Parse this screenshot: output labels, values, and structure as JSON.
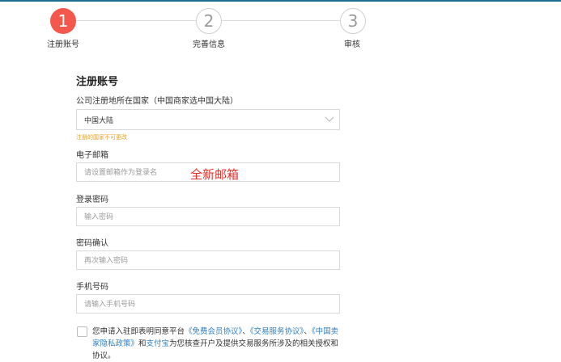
{
  "steps": [
    {
      "number": "1",
      "label": "注册账号",
      "state": "active"
    },
    {
      "number": "2",
      "label": "完善信息",
      "state": "idle"
    },
    {
      "number": "3",
      "label": "审核",
      "state": "idle"
    }
  ],
  "form": {
    "title": "注册账号",
    "country": {
      "label": "公司注册地所在国家（中国商家选中国大陆）",
      "value": "中国大陆",
      "warning": "注册的国家不可更改"
    },
    "email": {
      "label": "电子邮箱",
      "placeholder": "请设置邮箱作为登录名",
      "annotation": "全新邮箱"
    },
    "password": {
      "label": "登录密码",
      "placeholder": "输入密码"
    },
    "confirm": {
      "label": "密码确认",
      "placeholder": "再次输入密码"
    },
    "phone": {
      "label": "手机号码",
      "placeholder": "请输入手机号码"
    }
  },
  "agreement": {
    "prefix": "您申请入驻即表明同意平台",
    "link1": "《免费会员协议》",
    "sep1": "、",
    "link2": "《交易服务协议》",
    "sep2": "、",
    "link3": "《中国卖家隐私政策》",
    "mid": "和",
    "link4": "支付宝",
    "suffix": "为您核查开户及提供交易服务所涉及的相关授权和协议。"
  },
  "colors": {
    "accent": "#f4584c",
    "link": "#2f7fc1",
    "warning": "#e8a025",
    "annotation": "#e7312c"
  }
}
